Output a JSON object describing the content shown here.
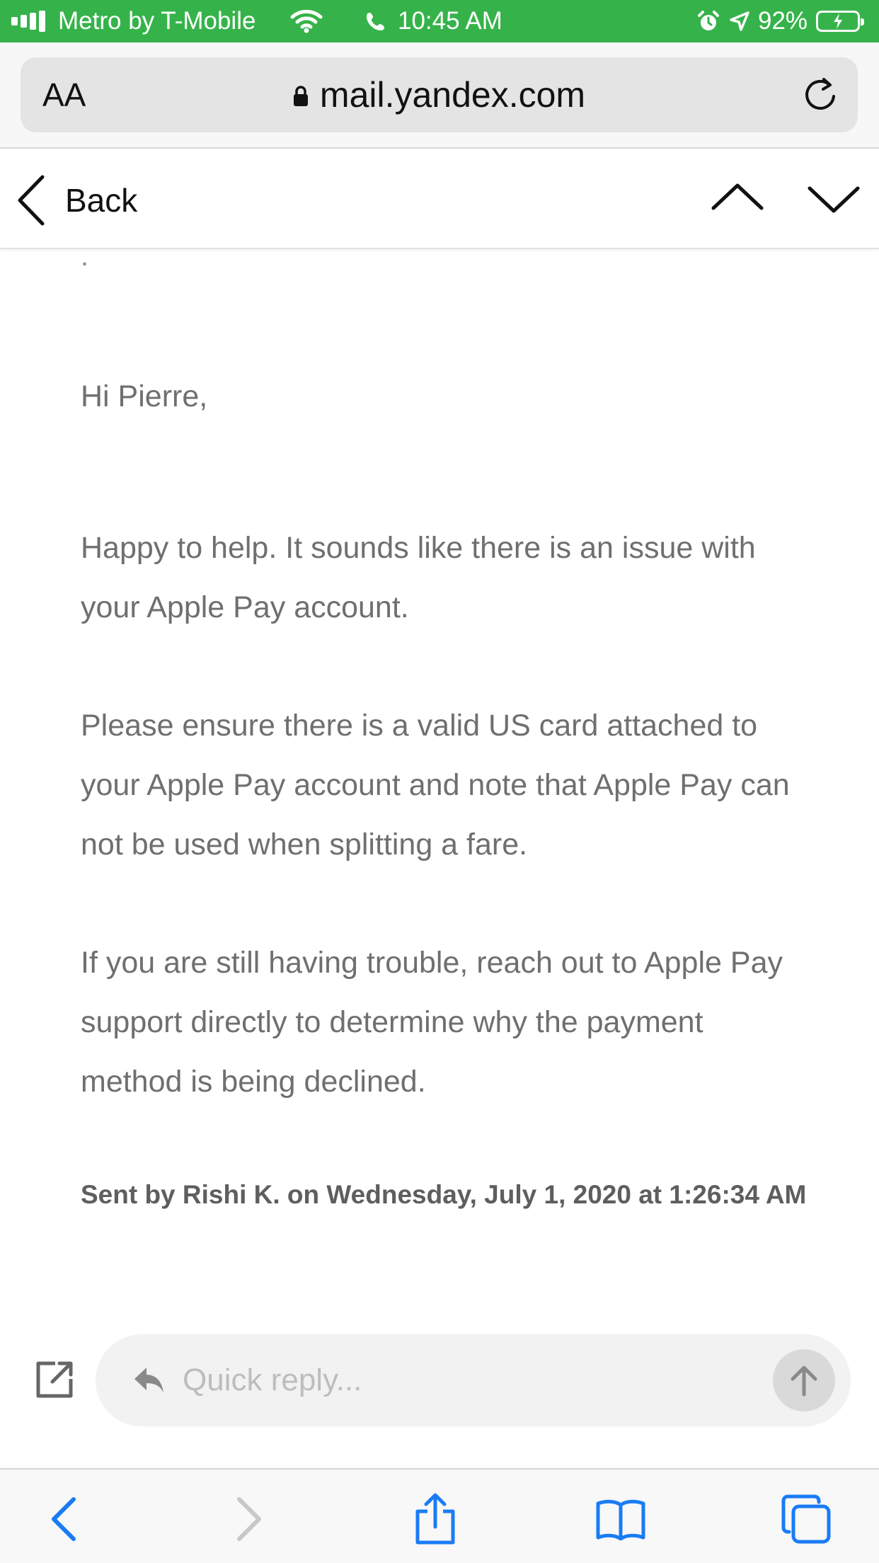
{
  "status_bar": {
    "carrier": "Metro by T-Mobile",
    "time": "10:45 AM",
    "battery": "92%",
    "icons": [
      "signal-icon",
      "wifi-icon",
      "phone-icon",
      "alarm-icon",
      "location-arrow-icon",
      "battery-charging-icon"
    ]
  },
  "address_bar": {
    "text_size_label": "AA",
    "url": "mail.yandex.com",
    "icons": [
      "lock-icon",
      "reload-icon"
    ]
  },
  "nav_header": {
    "back_label": "Back",
    "icons": [
      "chevron-left-icon",
      "chevron-up-icon",
      "chevron-down-icon"
    ]
  },
  "email": {
    "separator_dot": ".",
    "greeting": "Hi Pierre,",
    "paragraphs": [
      "Happy to help. It sounds like there is an issue with your Apple Pay account.",
      "Please ensure there is a valid US card attached to your Apple Pay account and note that Apple Pay can not be used when splitting a fare.",
      "If you are still having trouble, reach out to Apple Pay support directly to determine why the payment method is being declined."
    ],
    "signature": "Sent by Rishi K. on Wednesday, July 1, 2020 at 1:26:34 AM"
  },
  "quick_reply": {
    "placeholder": "Quick reply...",
    "icons": [
      "compose-icon",
      "reply-arrow-icon",
      "send-arrow-icon"
    ]
  },
  "toolbar": {
    "icons": [
      "back-icon",
      "forward-icon",
      "share-icon",
      "bookmarks-icon",
      "tabs-icon"
    ]
  },
  "colors": {
    "status_bar_bg": "#35b34a",
    "ios_blue": "#1a7cf5",
    "body_text": "#6f6f6f"
  }
}
